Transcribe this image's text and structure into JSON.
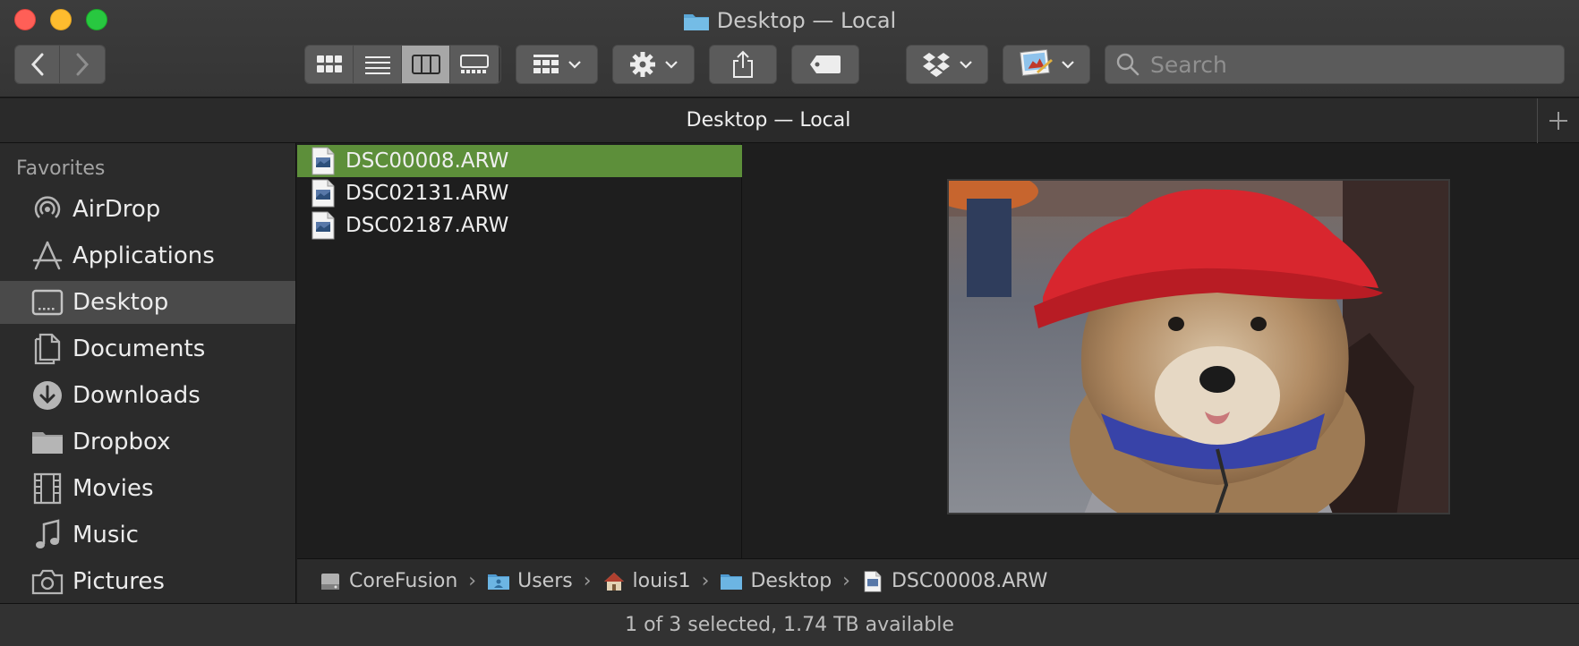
{
  "window": {
    "title": "Desktop — Local"
  },
  "toolbar": {
    "search_placeholder": "Search"
  },
  "tab": {
    "label": "Desktop — Local"
  },
  "sidebar": {
    "heading": "Favorites",
    "items": [
      {
        "label": "AirDrop",
        "icon": "airdrop-icon"
      },
      {
        "label": "Applications",
        "icon": "applications-icon"
      },
      {
        "label": "Desktop",
        "icon": "desktop-icon",
        "selected": true
      },
      {
        "label": "Documents",
        "icon": "documents-icon"
      },
      {
        "label": "Downloads",
        "icon": "downloads-icon"
      },
      {
        "label": "Dropbox",
        "icon": "folder-icon"
      },
      {
        "label": "Movies",
        "icon": "movies-icon"
      },
      {
        "label": "Music",
        "icon": "music-icon"
      },
      {
        "label": "Pictures",
        "icon": "pictures-icon"
      }
    ]
  },
  "files": [
    {
      "name": "DSC00008.ARW",
      "selected": true
    },
    {
      "name": "DSC02131.ARW"
    },
    {
      "name": "DSC02187.ARW"
    }
  ],
  "path": [
    {
      "label": "CoreFusion",
      "icon": "hard-drive-icon"
    },
    {
      "label": "Users",
      "icon": "users-folder-icon"
    },
    {
      "label": "louis1",
      "icon": "home-icon"
    },
    {
      "label": "Desktop",
      "icon": "folder-icon"
    },
    {
      "label": "DSC00008.ARW",
      "icon": "raw-file-icon"
    }
  ],
  "status": {
    "text": "1 of 3 selected, 1.74 TB available"
  },
  "colors": {
    "selection": "#5d8f3a",
    "close": "#ff5f57",
    "minimize": "#febc2e",
    "zoom": "#28c840"
  }
}
